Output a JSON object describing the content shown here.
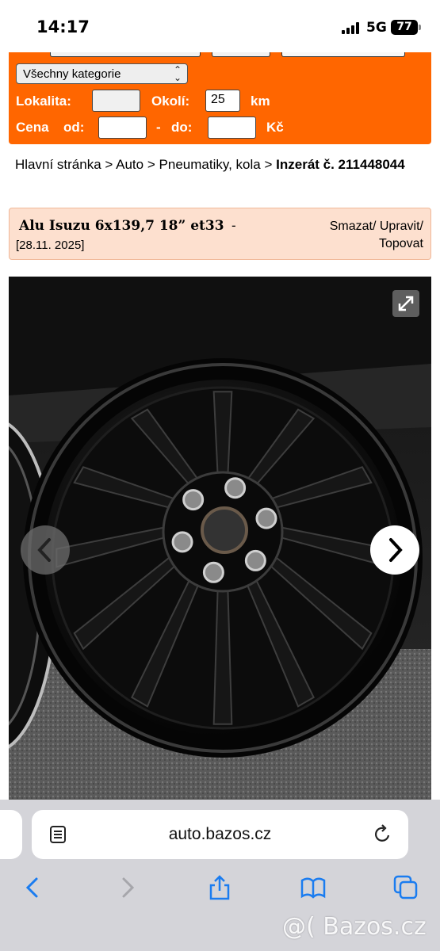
{
  "status_bar": {
    "time": "14:17",
    "network": "5G",
    "battery": "77"
  },
  "search": {
    "category_select": "Všechny kategorie",
    "location_label": "Lokalita:",
    "location_value": "",
    "radius_label": "Okolí:",
    "radius_value": "25",
    "radius_unit": "km",
    "price_label": "Cena",
    "price_from_label": "od:",
    "price_from_value": "",
    "price_dash": "-",
    "price_to_label": "do:",
    "price_to_value": "",
    "currency": "Kč"
  },
  "breadcrumb": {
    "home": "Hlavní stránka",
    "sep": ">",
    "auto": "Auto",
    "category": "Pneumatiky, kola",
    "current": "Inzerát č. 211448044"
  },
  "ad": {
    "title": "Alu Isuzu 6x139,7 18” et33",
    "dash": "-",
    "date": "[28.11. 2025]",
    "actions": "Smazat/ Upravit/ Topovat"
  },
  "gallery": {
    "expand_icon": "expand-icon",
    "prev_icon": "chevron-left-icon",
    "next_icon": "chevron-right-icon"
  },
  "browser": {
    "url": "auto.bazos.cz",
    "watermark": "@( Bazos.cz",
    "accent": "#1a7cf0"
  },
  "colors": {
    "brand": "#ff6600",
    "ad_header_bg": "#fde0cf"
  }
}
